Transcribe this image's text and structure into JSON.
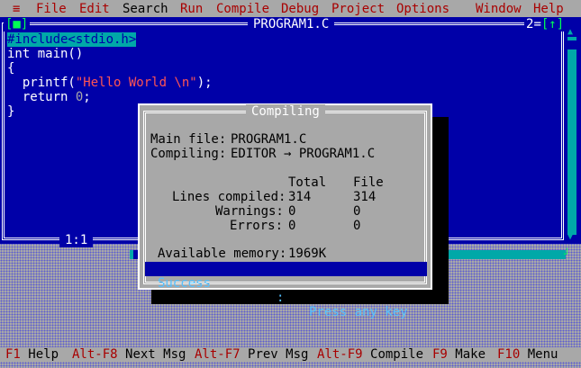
{
  "menu": {
    "system_icon": "≡",
    "items": [
      "File",
      "Edit",
      "Search",
      "Run",
      "Compile",
      "Debug",
      "Project",
      "Options",
      "Window",
      "Help"
    ]
  },
  "editor": {
    "title": "PROGRAM1.C",
    "close_box": "[■]",
    "window_number": "2",
    "zoom_box": "[↑]",
    "cursor_position": "1:1",
    "code_lines": [
      "#include<stdio.h>",
      "int main()",
      "{",
      "  printf(\"Hello World \\n\");",
      "  return 0;",
      "}"
    ]
  },
  "dialog": {
    "title": "Compiling",
    "main_file_label": "Main file:",
    "main_file": "PROGRAM1.C",
    "compiling_label": "Compiling:",
    "compiling_value": "EDITOR → PROGRAM1.C",
    "col_total": "Total",
    "col_file": "File",
    "rows": [
      {
        "label": "Lines compiled:",
        "total": "314",
        "file": "314"
      },
      {
        "label": "Warnings:",
        "total": "0",
        "file": "0"
      },
      {
        "label": "Errors:",
        "total": "0",
        "file": "0"
      }
    ],
    "memory_label": "Available memory:",
    "memory_value": "1969K",
    "status": "Success",
    "status_sep": ":",
    "status_prompt": "Press any key"
  },
  "hints": [
    {
      "key": "F1",
      "label": "Help"
    },
    {
      "key": "Alt-F8",
      "label": "Next Msg"
    },
    {
      "key": "Alt-F7",
      "label": "Prev Msg"
    },
    {
      "key": "Alt-F9",
      "label": "Compile"
    },
    {
      "key": "F9",
      "label": "Make"
    },
    {
      "key": "F10",
      "label": "Menu"
    }
  ]
}
